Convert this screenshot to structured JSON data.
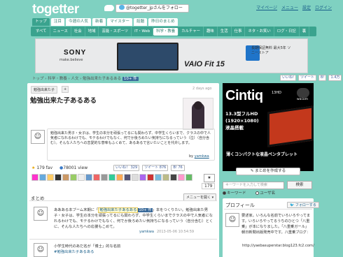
{
  "header": {
    "logo": "togetter",
    "follow_button": "@togetter_jpさんをフォロー",
    "links": [
      "マイページ",
      "メニュー",
      "設定",
      "ログイン"
    ]
  },
  "tabs": [
    "トップ",
    "注目",
    "今週の人気",
    "新着",
    "マイスター",
    "話題",
    "昨日のまとめ"
  ],
  "active_tab_index": 0,
  "categories": [
    "すべて",
    "ニュース",
    "社会",
    "地域",
    "芸能・スポーツ",
    "IT・Web",
    "科学・教養",
    "カルチャー",
    "趣味",
    "生活",
    "仕事",
    "ネタ・お笑い",
    "ログ・日記",
    "裏"
  ],
  "active_category_index": 6,
  "ad": {
    "brand": "SONY",
    "tagline": "make.believe",
    "product": "VAIO Fit 15",
    "side_text": "長期保証無料 最大5年 ソニーストア"
  },
  "breadcrumb": {
    "parts": [
      "トップ",
      "科学・教養",
      "人文"
    ],
    "current": "勉強出来た子あるある",
    "tag": "10+ 件"
  },
  "social_bar": [
    "いいね!",
    "ツイート",
    "B!",
    "1.4万"
  ],
  "main": {
    "tag_chip": "勉強出来た子",
    "plus": "+",
    "time_ago": "2 days ago",
    "title": "勉強出来た子あるある",
    "description": "勉強出来た男子・女子は、学生の本分を頑張ってるにも関わらず、中学生くらいまで、クラスの中で人気者になれるわけでも、モテるわけでもなく、何でか後ろめたい気持ちになるっていう（泣）（自分含む）。そんな人たちへの恋愛的な意味もふくめて、あるあるで言いたいことを代弁します。",
    "by_label": "by",
    "author": "yamkwa",
    "fav_count": "179",
    "fav_label": "fav",
    "view_count": "78001",
    "view_label": "view",
    "share": [
      {
        "label": "いいね！",
        "count": "329"
      },
      {
        "label": "ツイート",
        "count": "876"
      },
      {
        "label": "B!",
        "count": "76"
      }
    ],
    "fav_total": "179",
    "matome_label": "まとめ",
    "menu_button": "メニューを開く"
  },
  "tweets": [
    {
      "text_pre": "ああある本ブーム末期に「",
      "highlight": "勉強出来た子あるある",
      "tag": "10+ 件",
      "text_post": "」本をつくりたい。勉強出来た男子・女子は、学生の本分を頑張ってるにも関わらず、中学生くらいまでクラスの中で人気者になれるわけでも、モテるわけでもなく、何でか後ろめたい気持ちになるっていう（自分含む）とくに、そんな人たちへの応援もこめて。",
      "user": "yamkwa",
      "time": "2013-05-06 10:54:59"
    },
    {
      "text": "小学生時代のあだ名が「博士」的な名前",
      "hashtag": "#勉強出来た子あるある"
    }
  ],
  "sidebar": {
    "ad_brand": "Cintiq",
    "ad_model": "13HD",
    "ad_maker": "wacom",
    "ad_copy": [
      "13.3型フルHD",
      "(1920×1080)",
      "液晶搭載"
    ],
    "ad_footer": "薄くコンパクトな液晶ペンタブレット",
    "matome_button": "まとめを作成する",
    "search_placeholder": "キーワードを入力して検索",
    "search_button": "検索",
    "radio": [
      "キーワード",
      "ユーザ名"
    ],
    "profile_title": "プロフィール",
    "follow_button": "フォローする",
    "profile_text": "要述家。いろんな名前でいろいろやってます。いろいろやってるうちのひとつ「八重乗」が本になりました。「八重乗ガール」朝日新聞出版発売中です。八重乗ブログ：",
    "profile_url": "http://yaebasuperstar.blog123.fc2.com/"
  },
  "colors": {
    "bg": "#7fd1c1",
    "nav": "#3aa38e",
    "link": "#1a5f8a",
    "star": "#e8a600"
  }
}
